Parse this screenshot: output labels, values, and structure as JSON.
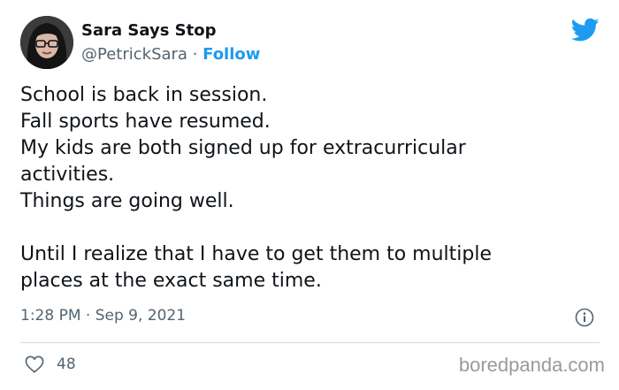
{
  "author": {
    "display_name": "Sara Says Stop",
    "handle": "@PetrickSara",
    "separator": " · ",
    "follow_label": "Follow"
  },
  "brand_icon": "twitter-bird-icon",
  "tweet": {
    "lines": [
      "School is back in session.",
      "Fall sports have resumed.",
      "My kids are both signed up for extracurricular",
      "activities.",
      "Things are going well.",
      "",
      "Until I realize that I have to get them to multiple",
      "places at the exact same time."
    ],
    "time": "1:28 PM",
    "meta_separator": " · ",
    "date": "Sep 9, 2021"
  },
  "engagement": {
    "likes": "48"
  },
  "watermark": "boredpanda.com",
  "colors": {
    "accent": "#1d9bf0",
    "text": "#0f1419",
    "secondary": "#536471",
    "divider": "#cfd9de"
  }
}
